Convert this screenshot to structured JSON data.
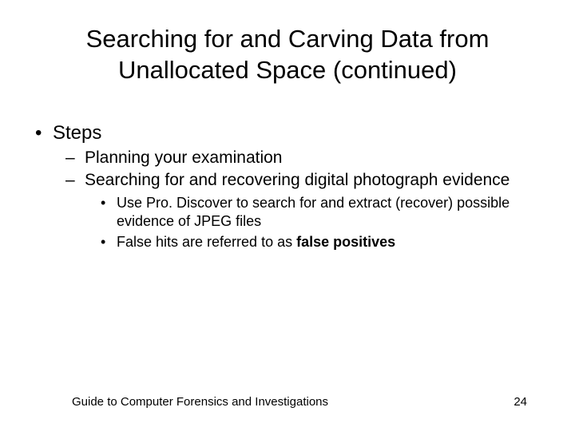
{
  "title": "Searching for and Carving Data from Unallocated Space (continued)",
  "bullet1": "Steps",
  "sub1": "Planning your examination",
  "sub2": "Searching for and recovering digital photograph evidence",
  "subsub1": "Use Pro. Discover to search for and extract (recover) possible evidence of JPEG files",
  "subsub2a": "False hits are referred to as ",
  "subsub2b": "false positives",
  "footer_text": "Guide to Computer Forensics and Investigations",
  "page_num": "24"
}
